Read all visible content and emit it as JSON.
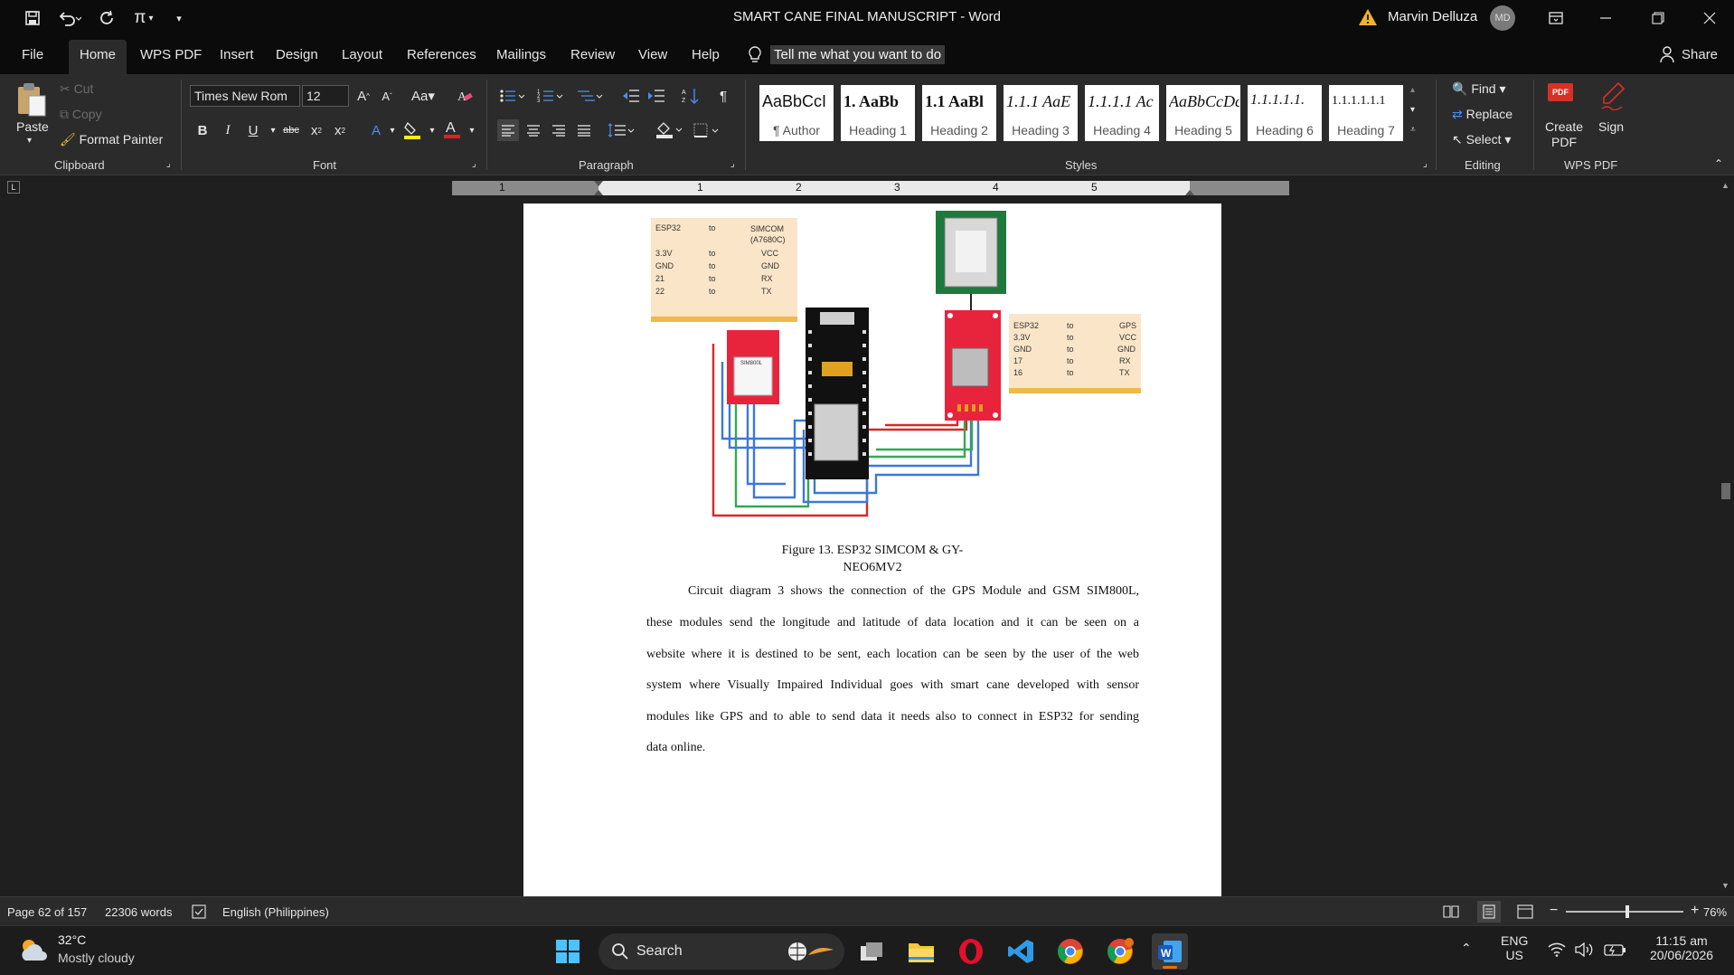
{
  "window": {
    "title": "SMART CANE FINAL MANUSCRIPT  -  Word",
    "user": "Marvin Delluza",
    "avatar_initials": "MD"
  },
  "menu": {
    "tabs": [
      "File",
      "Home",
      "WPS PDF",
      "Insert",
      "Design",
      "Layout",
      "References",
      "Mailings",
      "Review",
      "View",
      "Help"
    ],
    "active": "Home",
    "tell_me": "Tell me what you want to do",
    "share": "Share"
  },
  "ribbon": {
    "clipboard": {
      "paste": "Paste",
      "cut": "Cut",
      "copy": "Copy",
      "format_painter": "Format Painter",
      "label": "Clipboard"
    },
    "font": {
      "name": "Times New Rom",
      "size": "12",
      "change_case": "Aa",
      "label": "Font"
    },
    "paragraph": {
      "label": "Paragraph"
    },
    "styles": {
      "label": "Styles",
      "items": [
        {
          "preview": "AaBbCcI",
          "name": "¶ Author"
        },
        {
          "preview": "1.  AaBb",
          "name": "Heading 1"
        },
        {
          "preview": "1.1  AaBl",
          "name": "Heading 2"
        },
        {
          "preview": "1.1.1  AaE",
          "name": "Heading 3"
        },
        {
          "preview": "1.1.1.1  Ac",
          "name": "Heading 4"
        },
        {
          "preview": "AaBbCcDc",
          "name": "Heading 5"
        },
        {
          "preview": "1.1.1.1.1.",
          "name": "Heading 6"
        },
        {
          "preview": "1.1.1.1.1.1",
          "name": "Heading 7"
        }
      ]
    },
    "editing": {
      "find": "Find",
      "replace": "Replace",
      "select": "Select",
      "label": "Editing"
    },
    "wps_pdf": {
      "create": "Create PDF",
      "sign": "Sign",
      "label": "WPS PDF",
      "badge": "PDF"
    }
  },
  "ruler": {
    "numbers": [
      "1",
      "1",
      "2",
      "3",
      "4",
      "5"
    ]
  },
  "figure": {
    "simcom_note": {
      "header": [
        "ESP32",
        "to",
        "SIMCOM (A7680C)"
      ],
      "rows": [
        [
          "3.3V",
          "to",
          "VCC"
        ],
        [
          "GND",
          "to",
          "GND"
        ],
        [
          "21",
          "to",
          "RX"
        ],
        [
          "22",
          "to",
          "TX"
        ]
      ]
    },
    "gps_note": {
      "header": [
        "ESP32",
        "to",
        "GPS"
      ],
      "rows": [
        [
          "3.3V",
          "to",
          "VCC"
        ],
        [
          "GND",
          "to",
          "GND"
        ],
        [
          "17",
          "to",
          "RX"
        ],
        [
          "16",
          "to",
          "TX"
        ]
      ]
    },
    "caption_line1": "Figure 13. ESP32 SIMCOM & GY-",
    "caption_line2": "NEO6MV2"
  },
  "body": {
    "lines": [
      "Circuit diagram 3 shows the connection of the GPS Module and GSM SIM800L,",
      "these modules send the longitude and latitude of data location and it can be seen on a",
      "website where it is destined to be sent, each location can be seen by the user of the web",
      "system where Visually Impaired Individual goes with smart cane developed with sensor",
      "modules like GPS and to able to send data it needs also to connect in ESP32 for sending",
      "data online."
    ]
  },
  "status": {
    "page": "Page 62 of 157",
    "words": "22306 words",
    "language": "English (Philippines)",
    "zoom": "76%",
    "zoom_level_fraction": 0.52
  },
  "taskbar": {
    "weather_temp": "32°C",
    "weather_desc": "Mostly cloudy",
    "search": "Search",
    "lang1": "ENG",
    "lang2": "US",
    "time": "11:15 am",
    "date": "20/06/2026"
  },
  "colors": {
    "accent": "#185abd",
    "pcb_red": "#e8243c",
    "note_bg": "#fbe5c8",
    "note_border": "#f0b94a",
    "wire_blue": "#3c78d8",
    "wire_green": "#34a853",
    "wire_red": "#d62828"
  }
}
